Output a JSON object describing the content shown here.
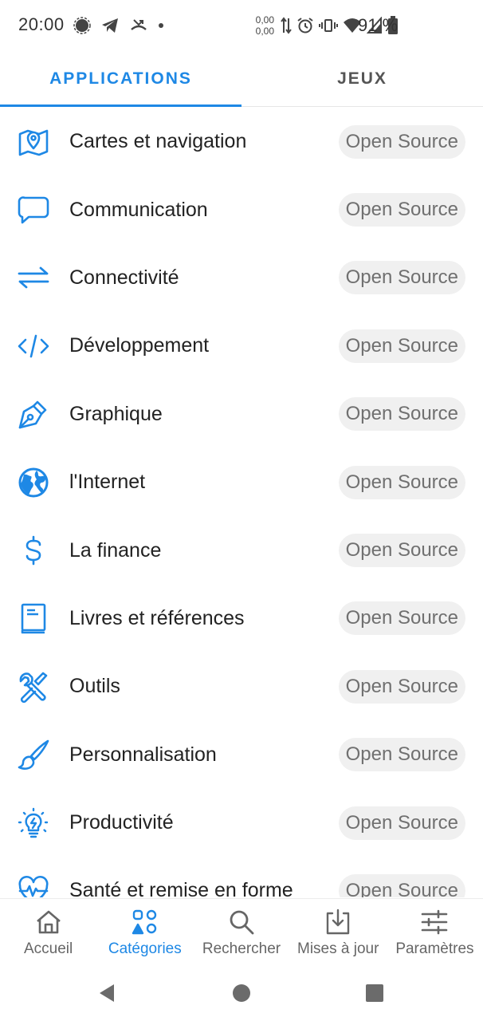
{
  "status_bar": {
    "time": "20:00",
    "data_rate_up": "0,00",
    "data_rate_down": "0,00",
    "battery": "91 %"
  },
  "tabs": [
    {
      "label": "APPLICATIONS",
      "active": true
    },
    {
      "label": "JEUX",
      "active": false
    }
  ],
  "categories": [
    {
      "label": "Cartes et navigation",
      "badge": "Open Source",
      "icon": "map-pin-icon"
    },
    {
      "label": "Communication",
      "badge": "Open Source",
      "icon": "chat-bubble-icon"
    },
    {
      "label": "Connectivité",
      "badge": "Open Source",
      "icon": "swap-arrows-icon"
    },
    {
      "label": "Développement",
      "badge": "Open Source",
      "icon": "code-icon"
    },
    {
      "label": "Graphique",
      "badge": "Open Source",
      "icon": "pen-nib-icon"
    },
    {
      "label": "l'Internet",
      "badge": "Open Source",
      "icon": "globe-icon"
    },
    {
      "label": "La finance",
      "badge": "Open Source",
      "icon": "dollar-icon"
    },
    {
      "label": "Livres et références",
      "badge": "Open Source",
      "icon": "book-icon"
    },
    {
      "label": "Outils",
      "badge": "Open Source",
      "icon": "tools-icon"
    },
    {
      "label": "Personnalisation",
      "badge": "Open Source",
      "icon": "brush-icon"
    },
    {
      "label": "Productivité",
      "badge": "Open Source",
      "icon": "lightbulb-icon"
    },
    {
      "label": "Santé et remise en forme",
      "badge": "Open Source",
      "icon": "heartbeat-icon"
    }
  ],
  "bottom_nav": [
    {
      "label": "Accueil",
      "icon": "home-icon",
      "active": false
    },
    {
      "label": "Catégories",
      "icon": "categories-icon",
      "active": true
    },
    {
      "label": "Rechercher",
      "icon": "search-icon",
      "active": false
    },
    {
      "label": "Mises à jour",
      "icon": "download-icon",
      "active": false
    },
    {
      "label": "Paramètres",
      "icon": "sliders-icon",
      "active": false
    }
  ],
  "colors": {
    "accent": "#1e88e5",
    "chip_bg": "#f0f0f0",
    "chip_text": "#707070"
  }
}
